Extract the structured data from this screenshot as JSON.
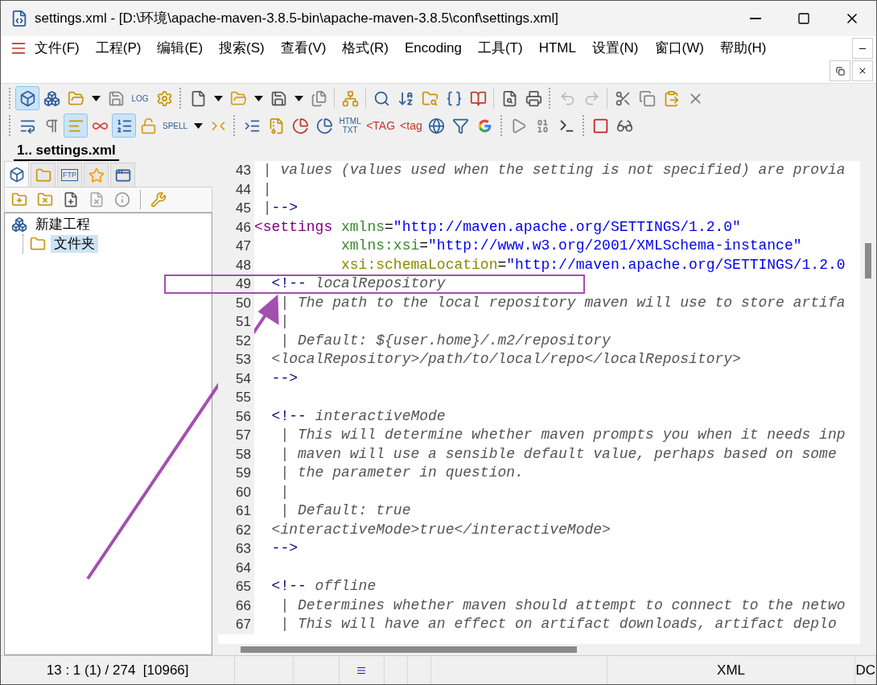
{
  "window": {
    "title": "settings.xml - [D:\\环境\\apache-maven-3.8.5-bin\\apache-maven-3.8.5\\conf\\settings.xml]"
  },
  "menu": [
    "文件(F)",
    "工程(P)",
    "编辑(E)",
    "搜索(S)",
    "查看(V)",
    "格式(R)",
    "Encoding",
    "工具(T)",
    "HTML",
    "设置(N)",
    "窗口(W)",
    "帮助(H)"
  ],
  "toolbars": [
    [
      {
        "kind": "grip"
      },
      {
        "kind": "cube",
        "pressed": true
      },
      {
        "kind": "cubes",
        "pressed": false
      },
      {
        "kind": "cube-folder",
        "pressed": false
      },
      {
        "kind": "caret"
      },
      {
        "kind": "save-gray",
        "pressed": false
      },
      {
        "kind": "label",
        "label": "LOG",
        "pressed": false
      },
      {
        "kind": "gear",
        "pressed": false
      },
      {
        "kind": "grip"
      },
      {
        "kind": "new-doc",
        "pressed": false
      },
      {
        "kind": "caret"
      },
      {
        "kind": "folder-open",
        "pressed": false
      },
      {
        "kind": "caret"
      },
      {
        "kind": "save",
        "pressed": false
      },
      {
        "kind": "caret"
      },
      {
        "kind": "save-all",
        "pressed": false
      },
      {
        "kind": "sep"
      },
      {
        "kind": "tree",
        "pressed": false
      },
      {
        "kind": "sep"
      },
      {
        "kind": "search",
        "pressed": false
      },
      {
        "kind": "sort",
        "pressed": false
      },
      {
        "kind": "folder-search",
        "pressed": false
      },
      {
        "kind": "braces",
        "pressed": false
      },
      {
        "kind": "book",
        "pressed": false
      },
      {
        "kind": "sep"
      },
      {
        "kind": "doc-search",
        "pressed": false
      },
      {
        "kind": "printer",
        "pressed": false
      },
      {
        "kind": "grip"
      },
      {
        "kind": "undo",
        "pressed": false
      },
      {
        "kind": "redo",
        "pressed": false
      },
      {
        "kind": "sep"
      },
      {
        "kind": "cut",
        "pressed": false
      },
      {
        "kind": "copy",
        "pressed": false
      },
      {
        "kind": "paste",
        "pressed": false
      },
      {
        "kind": "delete",
        "pressed": false
      }
    ],
    [
      {
        "kind": "grip"
      },
      {
        "kind": "wrap",
        "pressed": false
      },
      {
        "kind": "pilcrow",
        "pressed": false
      },
      {
        "kind": "align",
        "pressed": true
      },
      {
        "kind": "infinity",
        "pressed": false
      },
      {
        "kind": "numbered",
        "pressed": true
      },
      {
        "kind": "lock",
        "pressed": false
      },
      {
        "kind": "label",
        "label": "SPELL",
        "pressed": false
      },
      {
        "kind": "caret"
      },
      {
        "kind": "collapse",
        "pressed": false
      },
      {
        "kind": "grip"
      },
      {
        "kind": "indent",
        "pressed": false
      },
      {
        "kind": "archive",
        "pressed": false
      },
      {
        "kind": "pie",
        "pressed": false
      },
      {
        "kind": "pie-blue",
        "pressed": false
      },
      {
        "kind": "label",
        "label": "HTML TXT",
        "pressed": false
      },
      {
        "kind": "tag",
        "label": "<TAG",
        "pressed": false
      },
      {
        "kind": "tag",
        "label": "<tag",
        "pressed": false
      },
      {
        "kind": "web-doc",
        "pressed": false
      },
      {
        "kind": "filter",
        "pressed": false
      },
      {
        "kind": "google",
        "pressed": false
      },
      {
        "kind": "grip"
      },
      {
        "kind": "play",
        "pressed": false
      },
      {
        "kind": "binary",
        "pressed": false
      },
      {
        "kind": "terminal",
        "pressed": false
      },
      {
        "kind": "grip"
      },
      {
        "kind": "stop",
        "pressed": false
      },
      {
        "kind": "glasses",
        "pressed": false
      }
    ]
  ],
  "document_tab": {
    "label": "1.. settings.xml",
    "selected": true
  },
  "panel_tabs": [
    {
      "kind": "cube",
      "selected": true
    },
    {
      "kind": "folder",
      "selected": false
    },
    {
      "kind": "ftp",
      "label": "FTP",
      "selected": false
    },
    {
      "kind": "star",
      "selected": false
    },
    {
      "kind": "windows",
      "selected": false
    }
  ],
  "panel_tools": [
    {
      "kind": "folder-plus"
    },
    {
      "kind": "folder-x"
    },
    {
      "kind": "file-plus"
    },
    {
      "kind": "file-x"
    },
    {
      "kind": "info"
    },
    {
      "kind": "sep"
    },
    {
      "kind": "wrench"
    }
  ],
  "tree": [
    {
      "label": "新建工程",
      "kind": "project",
      "selected": false,
      "children": [
        {
          "label": "文件夹",
          "kind": "folder",
          "selected": true
        }
      ]
    }
  ],
  "code_lines": [
    {
      "number": "43",
      "marked": false,
      "segments": [
        {
          "kind": "comment",
          "text": " | values (values used when the setting is not specified) are provia"
        }
      ]
    },
    {
      "number": "44",
      "marked": false,
      "segments": [
        {
          "kind": "comment",
          "text": " |"
        }
      ]
    },
    {
      "number": "45",
      "marked": false,
      "segments": [
        {
          "kind": "comment",
          "text": " |"
        },
        {
          "kind": "mark",
          "text": "-->"
        }
      ]
    },
    {
      "number": "46",
      "marked": false,
      "segments": [
        {
          "kind": "tag",
          "text": "<settings"
        },
        {
          "kind": "attr",
          "text": " xmlns"
        },
        {
          "kind": "text",
          "text": "="
        },
        {
          "kind": "string",
          "text": "\"http://maven.apache.org/SETTINGS/1.2.0\""
        }
      ]
    },
    {
      "number": "47",
      "marked": false,
      "segments": [
        {
          "kind": "attr",
          "text": "          xmlns:xsi"
        },
        {
          "kind": "text",
          "text": "="
        },
        {
          "kind": "string",
          "text": "\"http://www.w3.org/2001/XMLSchema-instance\""
        }
      ]
    },
    {
      "number": "48",
      "marked": false,
      "segments": [
        {
          "kind": "attr2",
          "text": "          xsi:schemaLocation"
        },
        {
          "kind": "text",
          "text": "="
        },
        {
          "kind": "string",
          "text": "\"http://maven.apache.org/SETTINGS/1.2.0"
        }
      ]
    },
    {
      "number": "49",
      "marked": true,
      "segments": [
        {
          "kind": "mark",
          "text": "  <!--"
        },
        {
          "kind": "comment",
          "text": " localRepository"
        }
      ]
    },
    {
      "number": "50",
      "marked": false,
      "segments": [
        {
          "kind": "comment",
          "text": "   | The path to the local repository maven will use to store artifa"
        }
      ]
    },
    {
      "number": "51",
      "marked": false,
      "segments": [
        {
          "kind": "comment",
          "text": "   |"
        }
      ]
    },
    {
      "number": "52",
      "marked": false,
      "segments": [
        {
          "kind": "comment",
          "text": "   | Default: ${user.home}/.m2/repository"
        }
      ]
    },
    {
      "number": "53",
      "marked": false,
      "segments": [
        {
          "kind": "comment",
          "text": "  <localRepository>/path/to/local/repo</localRepository>"
        }
      ]
    },
    {
      "number": "54",
      "marked": false,
      "segments": [
        {
          "kind": "mark",
          "text": "  -->"
        }
      ]
    },
    {
      "number": "55",
      "marked": false
    },
    {
      "number": "56",
      "marked": false,
      "segments": [
        {
          "kind": "mark",
          "text": "  <!--"
        },
        {
          "kind": "comment",
          "text": " interactiveMode"
        }
      ]
    },
    {
      "number": "57",
      "marked": false,
      "segments": [
        {
          "kind": "comment",
          "text": "   | This will determine whether maven prompts you when it needs inp"
        }
      ]
    },
    {
      "number": "58",
      "marked": false,
      "segments": [
        {
          "kind": "comment",
          "text": "   | maven will use a sensible default value, perhaps based on some"
        }
      ]
    },
    {
      "number": "59",
      "marked": false,
      "segments": [
        {
          "kind": "comment",
          "text": "   | the parameter in question."
        }
      ]
    },
    {
      "number": "60",
      "marked": false,
      "segments": [
        {
          "kind": "comment",
          "text": "   |"
        }
      ]
    },
    {
      "number": "61",
      "marked": false,
      "segments": [
        {
          "kind": "comment",
          "text": "   | Default: true"
        }
      ]
    },
    {
      "number": "62",
      "marked": false,
      "segments": [
        {
          "kind": "comment",
          "text": "  <interactiveMode>true</interactiveMode>"
        }
      ]
    },
    {
      "number": "63",
      "marked": false,
      "segments": [
        {
          "kind": "mark",
          "text": "  -->"
        }
      ]
    },
    {
      "number": "64",
      "marked": false
    },
    {
      "number": "65",
      "marked": false,
      "segments": [
        {
          "kind": "mark",
          "text": "  <!--"
        },
        {
          "kind": "comment",
          "text": " offline"
        }
      ]
    },
    {
      "number": "66",
      "marked": false,
      "segments": [
        {
          "kind": "comment",
          "text": "   | Determines whether maven should attempt to connect to the netwo"
        }
      ]
    },
    {
      "number": "67",
      "marked": false,
      "segments": [
        {
          "kind": "comment",
          "text": "   | This will have an effect on artifact downloads, artifact deplo"
        }
      ]
    }
  ],
  "status_bar": [
    {
      "kind": "text",
      "text": "13 : 1 (1) / 274  [10966]"
    },
    {
      "kind": "empty"
    },
    {
      "kind": "empty"
    },
    {
      "kind": "icon"
    },
    {
      "kind": "empty"
    },
    {
      "kind": "empty"
    },
    {
      "kind": "empty"
    },
    {
      "kind": "text",
      "text": "XML"
    },
    {
      "kind": "text",
      "text": "DC"
    }
  ]
}
